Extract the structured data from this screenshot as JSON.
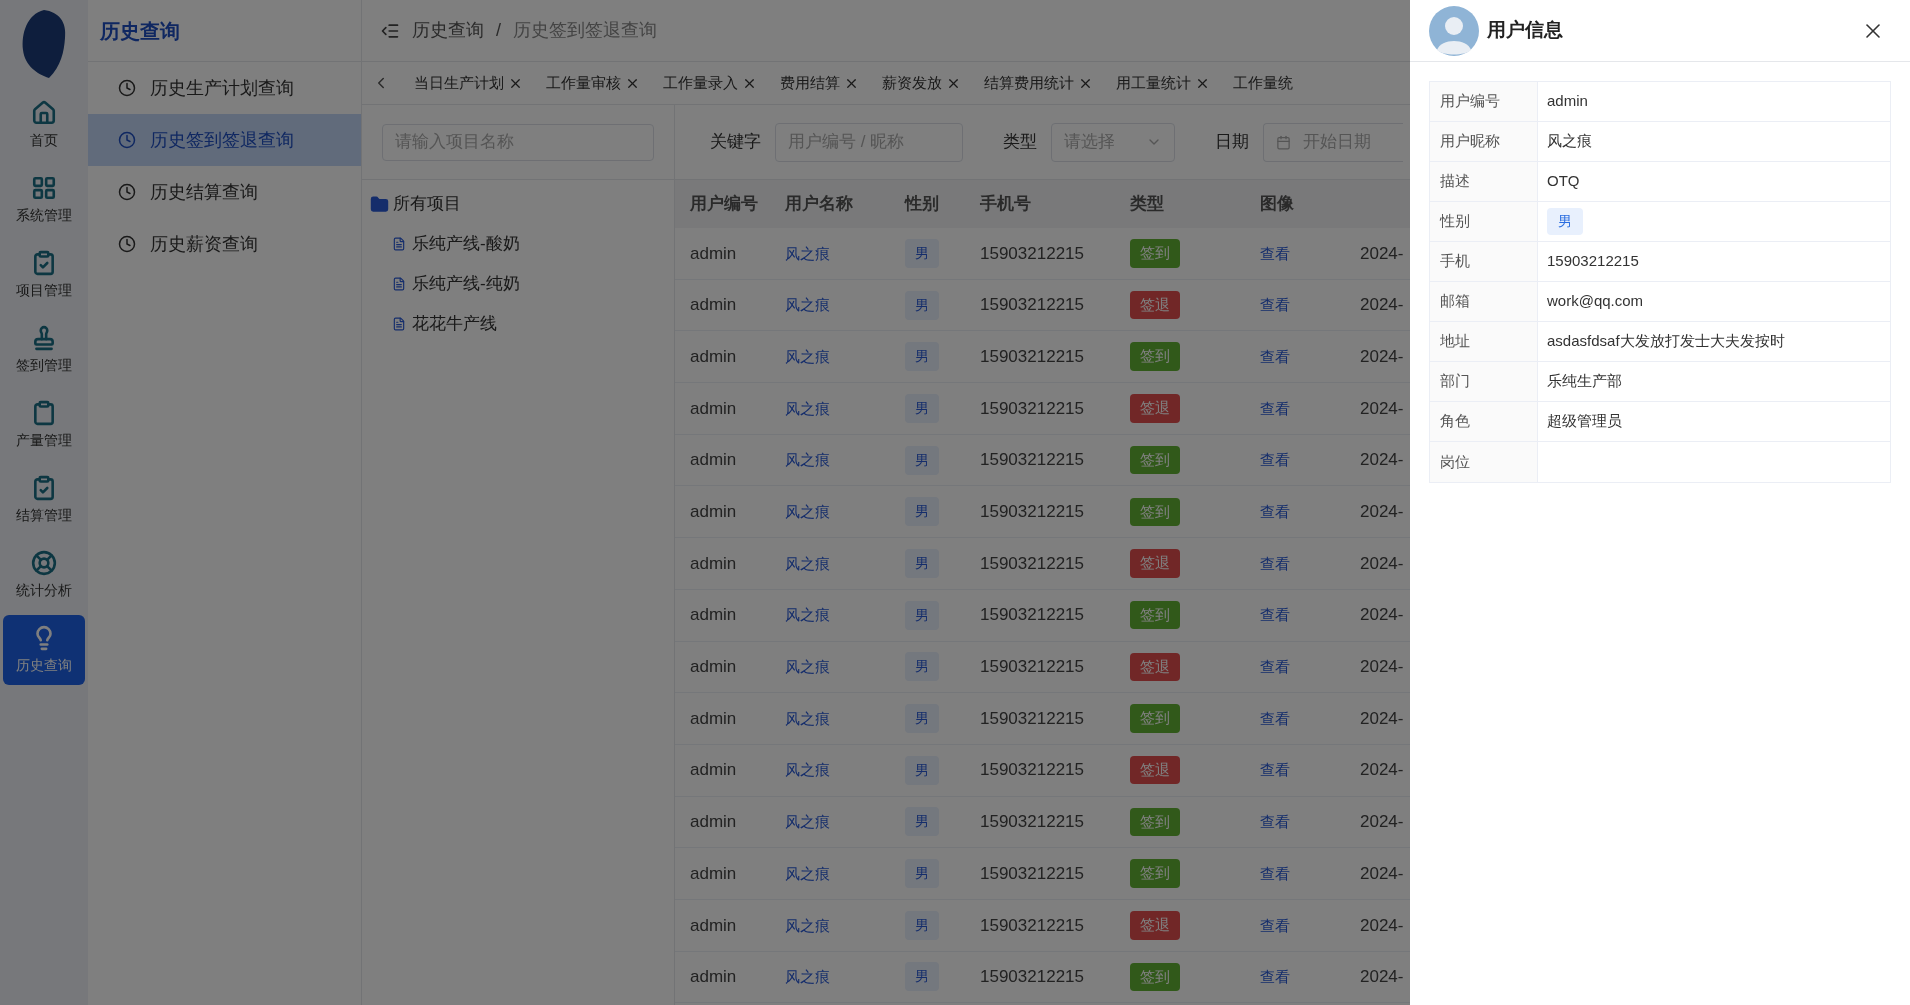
{
  "sidebar": {
    "items": [
      {
        "label": "首页",
        "selected": false
      },
      {
        "label": "系统管理",
        "selected": false
      },
      {
        "label": "项目管理",
        "selected": false
      },
      {
        "label": "签到管理",
        "selected": false
      },
      {
        "label": "产量管理",
        "selected": false
      },
      {
        "label": "结算管理",
        "selected": false
      },
      {
        "label": "统计分析",
        "selected": false
      },
      {
        "label": "历史查询",
        "selected": true
      }
    ]
  },
  "submenu": {
    "title": "历史查询",
    "items": [
      {
        "label": "历史生产计划查询",
        "selected": false
      },
      {
        "label": "历史签到签退查询",
        "selected": true
      },
      {
        "label": "历史结算查询",
        "selected": false
      },
      {
        "label": "历史薪资查询",
        "selected": false
      }
    ]
  },
  "breadcrumb": {
    "items": [
      "历史查询",
      "历史签到签退查询"
    ],
    "separator": "/"
  },
  "tabs": [
    {
      "label": "当日生产计划",
      "closable": true
    },
    {
      "label": "工作量审核",
      "closable": true
    },
    {
      "label": "工作量录入",
      "closable": true
    },
    {
      "label": "费用结算",
      "closable": true
    },
    {
      "label": "薪资发放",
      "closable": true
    },
    {
      "label": "结算费用统计",
      "closable": true
    },
    {
      "label": "用工量统计",
      "closable": true
    },
    {
      "label": "工作量统",
      "closable": false
    }
  ],
  "project_tree": {
    "search_placeholder": "请输入项目名称",
    "root": {
      "label": "所有项目",
      "children": [
        {
          "label": "乐纯产线-酸奶"
        },
        {
          "label": "乐纯产线-纯奶"
        },
        {
          "label": "花花牛产线"
        }
      ]
    }
  },
  "filters": {
    "keyword": {
      "label": "关键字",
      "placeholder": "用户编号 / 昵称"
    },
    "type": {
      "label": "类型",
      "placeholder": "请选择"
    },
    "date": {
      "label": "日期",
      "placeholder": "开始日期"
    }
  },
  "table": {
    "columns": [
      "用户编号",
      "用户名称",
      "性别",
      "手机号",
      "类型",
      "图像"
    ],
    "rows": [
      {
        "user_id": "admin",
        "name": "风之痕",
        "gender": "男",
        "phone": "15903212215",
        "type": "签到",
        "kind": "in",
        "image": "查看",
        "column_7": "2024-"
      },
      {
        "user_id": "admin",
        "name": "风之痕",
        "gender": "男",
        "phone": "15903212215",
        "type": "签退",
        "kind": "out",
        "image": "查看",
        "column_7": "2024-"
      },
      {
        "user_id": "admin",
        "name": "风之痕",
        "gender": "男",
        "phone": "15903212215",
        "type": "签到",
        "kind": "in",
        "image": "查看",
        "column_7": "2024-"
      },
      {
        "user_id": "admin",
        "name": "风之痕",
        "gender": "男",
        "phone": "15903212215",
        "type": "签退",
        "kind": "out",
        "image": "查看",
        "column_7": "2024-"
      },
      {
        "user_id": "admin",
        "name": "风之痕",
        "gender": "男",
        "phone": "15903212215",
        "type": "签到",
        "kind": "in",
        "image": "查看",
        "column_7": "2024-"
      },
      {
        "user_id": "admin",
        "name": "风之痕",
        "gender": "男",
        "phone": "15903212215",
        "type": "签到",
        "kind": "in",
        "image": "查看",
        "column_7": "2024-"
      },
      {
        "user_id": "admin",
        "name": "风之痕",
        "gender": "男",
        "phone": "15903212215",
        "type": "签退",
        "kind": "out",
        "image": "查看",
        "column_7": "2024-"
      },
      {
        "user_id": "admin",
        "name": "风之痕",
        "gender": "男",
        "phone": "15903212215",
        "type": "签到",
        "kind": "in",
        "image": "查看",
        "column_7": "2024-"
      },
      {
        "user_id": "admin",
        "name": "风之痕",
        "gender": "男",
        "phone": "15903212215",
        "type": "签退",
        "kind": "out",
        "image": "查看",
        "column_7": "2024-"
      },
      {
        "user_id": "admin",
        "name": "风之痕",
        "gender": "男",
        "phone": "15903212215",
        "type": "签到",
        "kind": "in",
        "image": "查看",
        "column_7": "2024-"
      },
      {
        "user_id": "admin",
        "name": "风之痕",
        "gender": "男",
        "phone": "15903212215",
        "type": "签退",
        "kind": "out",
        "image": "查看",
        "column_7": "2024-"
      },
      {
        "user_id": "admin",
        "name": "风之痕",
        "gender": "男",
        "phone": "15903212215",
        "type": "签到",
        "kind": "in",
        "image": "查看",
        "column_7": "2024-"
      },
      {
        "user_id": "admin",
        "name": "风之痕",
        "gender": "男",
        "phone": "15903212215",
        "type": "签到",
        "kind": "in",
        "image": "查看",
        "column_7": "2024-"
      },
      {
        "user_id": "admin",
        "name": "风之痕",
        "gender": "男",
        "phone": "15903212215",
        "type": "签退",
        "kind": "out",
        "image": "查看",
        "column_7": "2024-"
      },
      {
        "user_id": "admin",
        "name": "风之痕",
        "gender": "男",
        "phone": "15903212215",
        "type": "签到",
        "kind": "in",
        "image": "查看",
        "column_7": "2024-"
      }
    ]
  },
  "drawer": {
    "title": "用户信息",
    "fields": [
      {
        "label": "用户编号",
        "value": "admin",
        "kind": "text"
      },
      {
        "label": "用户昵称",
        "value": "风之痕",
        "kind": "text"
      },
      {
        "label": "描述",
        "value": "OTQ",
        "kind": "text"
      },
      {
        "label": "性别",
        "value": "男",
        "kind": "tag"
      },
      {
        "label": "手机",
        "value": "15903212215",
        "kind": "text"
      },
      {
        "label": "邮箱",
        "value": "work@qq.com",
        "kind": "text"
      },
      {
        "label": "地址",
        "value": "asdasfdsaf大发放打发士大夫发按时",
        "kind": "text"
      },
      {
        "label": "部门",
        "value": "乐纯生产部",
        "kind": "text"
      },
      {
        "label": "角色",
        "value": "超级管理员",
        "kind": "text"
      },
      {
        "label": "岗位"
      }
    ]
  }
}
